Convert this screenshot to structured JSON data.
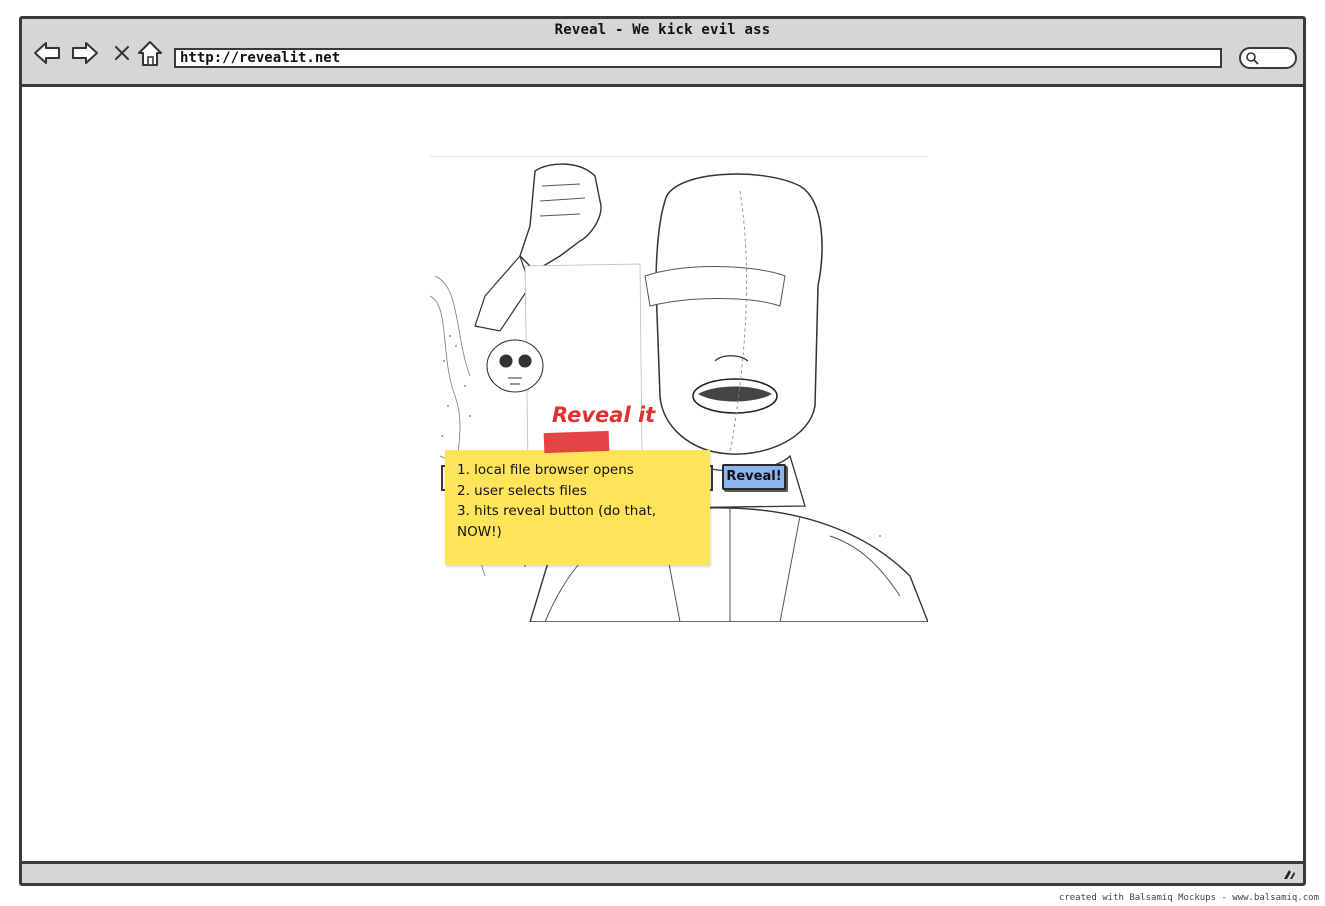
{
  "window": {
    "title": "Reveal - We kick evil ass"
  },
  "toolbar": {
    "icons": [
      "back-arrow-icon",
      "forward-arrow-icon",
      "stop-icon",
      "home-icon"
    ],
    "url": "http://revealit.net",
    "search_icon": "search-icon"
  },
  "content": {
    "image": "sketch-photo-masked-person",
    "reveal_button_label": "Reveal!",
    "annotation": {
      "title": "Reveal it",
      "lines": [
        "1. local file browser opens",
        "2. user selects files",
        "3. hits reveal button (do that, NOW!)"
      ],
      "note_color": "#ffe45a",
      "tape_color": "#e23b3b",
      "title_color": "#e03030"
    }
  },
  "footer": {
    "credit": "created with Balsamiq Mockups - www.balsamiq.com"
  },
  "colors": {
    "chrome": "#d6d6d6",
    "border": "#3a3a3a",
    "button": "#8db4f0"
  }
}
